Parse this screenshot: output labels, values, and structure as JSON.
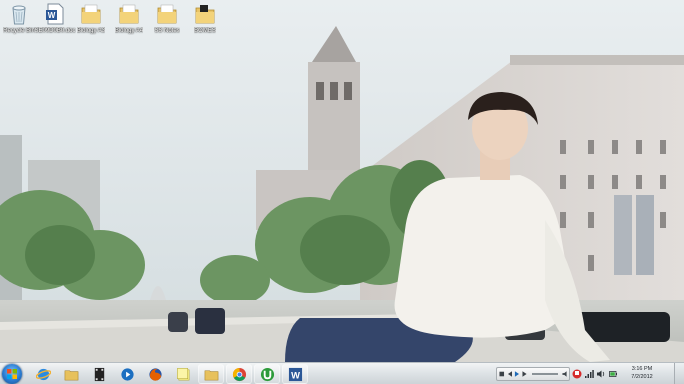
{
  "desktop": {
    "icons": [
      {
        "label": "Recycle Bin",
        "icon": "recycle-bin-icon"
      },
      {
        "label": "SE09D0B0.doc",
        "icon": "word-document-icon"
      },
      {
        "label": "Biology A3",
        "icon": "folder-icon"
      },
      {
        "label": "Biology A4",
        "icon": "folder-icon"
      },
      {
        "label": "SS Notes",
        "icon": "folder-icon"
      },
      {
        "label": "BOMES",
        "icon": "folder-icon"
      }
    ]
  },
  "taskbar": {
    "start_icon": "windows-start-icon",
    "apps": [
      {
        "name": "internet-explorer",
        "icon": "internet-explorer-icon",
        "pinned": false
      },
      {
        "name": "file-explorer",
        "icon": "folder-icon",
        "pinned": false
      },
      {
        "name": "media-center",
        "icon": "media-film-icon",
        "pinned": false
      },
      {
        "name": "windows-media-player",
        "icon": "media-player-icon",
        "pinned": false
      },
      {
        "name": "firefox",
        "icon": "firefox-icon",
        "pinned": false
      },
      {
        "name": "sticky-notes",
        "icon": "notes-icon",
        "pinned": false
      },
      {
        "name": "explorer-open",
        "icon": "folder-icon",
        "pinned": true
      },
      {
        "name": "chrome",
        "icon": "chrome-icon",
        "pinned": true
      },
      {
        "name": "utorrent",
        "icon": "utorrent-icon",
        "pinned": true
      },
      {
        "name": "word",
        "icon": "word-icon",
        "pinned": true
      }
    ],
    "tray_icons": [
      "flag-icon",
      "network-icon",
      "volume-icon",
      "power-icon"
    ],
    "clock": {
      "time": "3:16 PM",
      "date": "7/2/2012"
    }
  },
  "colors": {
    "sky": "#dde6ea",
    "taskbar": "#dfe4e7",
    "sweater": "#f1efe9",
    "jeans": "#2f3f5e",
    "trees": "#5f8f55"
  }
}
